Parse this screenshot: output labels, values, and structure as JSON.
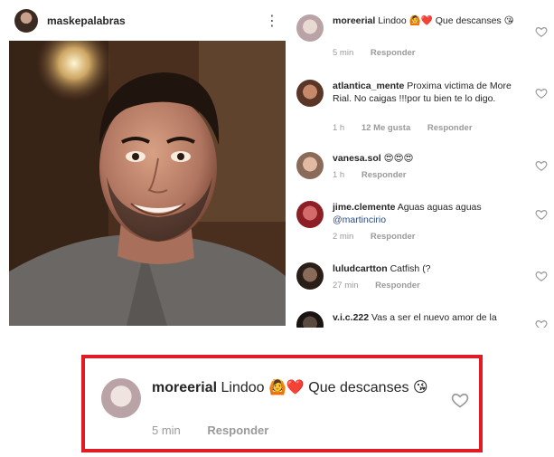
{
  "post": {
    "username": "maskepalabras",
    "more_glyph": "⋮",
    "icons": {
      "avatar": "avatar-icon",
      "more": "more-options-icon"
    }
  },
  "comments": [
    {
      "user": "moreerial",
      "text": "Lindoo 🙆❤️ Que descanses 😘",
      "time": "5 min",
      "likes": "",
      "reply": "Responder"
    },
    {
      "user": "atlantica_mente",
      "text": "Proxima victima de More Rial. No caigas !!!por tu bien te lo digo.",
      "time": "1 h",
      "likes": "12 Me gusta",
      "reply": "Responder"
    },
    {
      "user": "vanesa.sol",
      "text": "😍😍😍",
      "time": "1 h",
      "likes": "",
      "reply": "Responder"
    },
    {
      "user": "jime.clemente",
      "text": "Aguas aguas aguas",
      "mention": "@martincirio",
      "time": "2 min",
      "likes": "",
      "reply": "Responder"
    },
    {
      "user": "luludcartton",
      "text": "Catfish (?",
      "time": "27 min",
      "likes": "",
      "reply": "Responder"
    },
    {
      "user": "v.i.c.222",
      "text": "Vas a ser el nuevo amor de la",
      "time": "",
      "likes": "",
      "reply": ""
    }
  ],
  "zoom": {
    "user": "moreerial",
    "text": "Lindoo 🙆❤️ Que descanses 😘",
    "time": "5 min",
    "reply": "Responder"
  },
  "colors": {
    "highlight_border": "#e01b24",
    "meta_text": "#9a9a9a",
    "mention": "#2a4b7c"
  }
}
